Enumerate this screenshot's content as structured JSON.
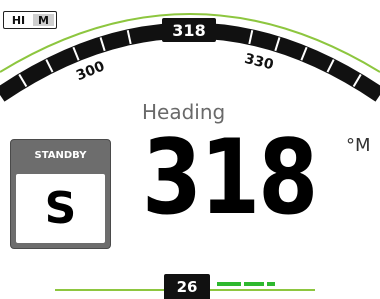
{
  "mode_toggle": {
    "hi_label": "HI",
    "m_label": "M",
    "active": "M"
  },
  "compass": {
    "current_heading": "318",
    "scale_labels": [
      "300",
      "330"
    ],
    "colors": {
      "band": "#111111",
      "arc": "#8dc63f",
      "ticks": "#ffffff"
    }
  },
  "heading": {
    "label": "Heading",
    "value": "318",
    "unit": "°M"
  },
  "standby": {
    "title": "STANDBY",
    "mode_letter": "S"
  },
  "footer": {
    "value": "26",
    "colors": {
      "line": "#8dc63f",
      "rudder": "#2eb82e"
    }
  }
}
